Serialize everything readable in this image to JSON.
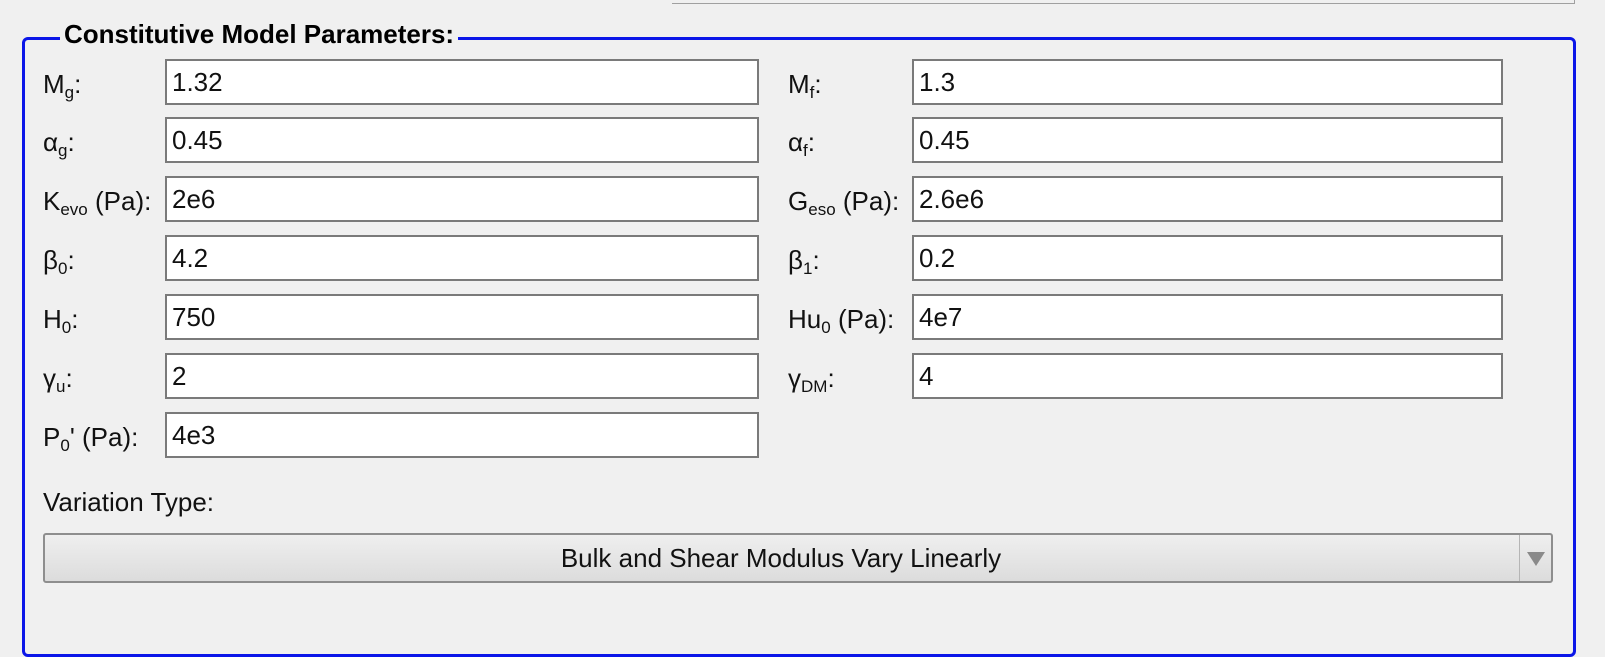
{
  "group": {
    "title": "Constitutive Model Parameters:"
  },
  "fields": {
    "Mg": {
      "sym": "M",
      "sub": "g",
      "suffix": ":",
      "value": "1.32"
    },
    "Mf": {
      "sym": "M",
      "sub": "f",
      "suffix": ":",
      "value": "1.3"
    },
    "ag": {
      "sym": "α",
      "sub": "g",
      "suffix": ":",
      "value": "0.45"
    },
    "af": {
      "sym": "α",
      "sub": "f",
      "suffix": ":",
      "value": "0.45"
    },
    "Kevo": {
      "sym": "K",
      "sub": "evo",
      "suffix": " (Pa):",
      "value": "2e6"
    },
    "Geso": {
      "sym": "G",
      "sub": "eso",
      "suffix": " (Pa):",
      "value": "2.6e6"
    },
    "b0": {
      "sym": "β",
      "sub": "0",
      "suffix": ":",
      "value": "4.2"
    },
    "b1": {
      "sym": "β",
      "sub": "1",
      "suffix": ":",
      "value": "0.2"
    },
    "H0": {
      "sym": "H",
      "sub": "0",
      "suffix": ":",
      "value": "750"
    },
    "Hu0": {
      "sym": "Hu",
      "sub": "0",
      "suffix": " (Pa):",
      "value": "4e7"
    },
    "gu": {
      "sym": "γ",
      "sub": "u",
      "suffix": ":",
      "value": "2"
    },
    "gDM": {
      "sym": "γ",
      "sub": "DM",
      "suffix": ":",
      "value": "4"
    },
    "P0": {
      "sym": "P",
      "sub": "0",
      "suffix": "' (Pa):",
      "value": "4e3"
    }
  },
  "variation": {
    "label": "Variation Type:",
    "selected": "Bulk and Shear Modulus Vary Linearly",
    "arrow_icon": "triangle-down"
  },
  "colors": {
    "group_border": "#0b16e8",
    "background": "#f0f0f0"
  }
}
